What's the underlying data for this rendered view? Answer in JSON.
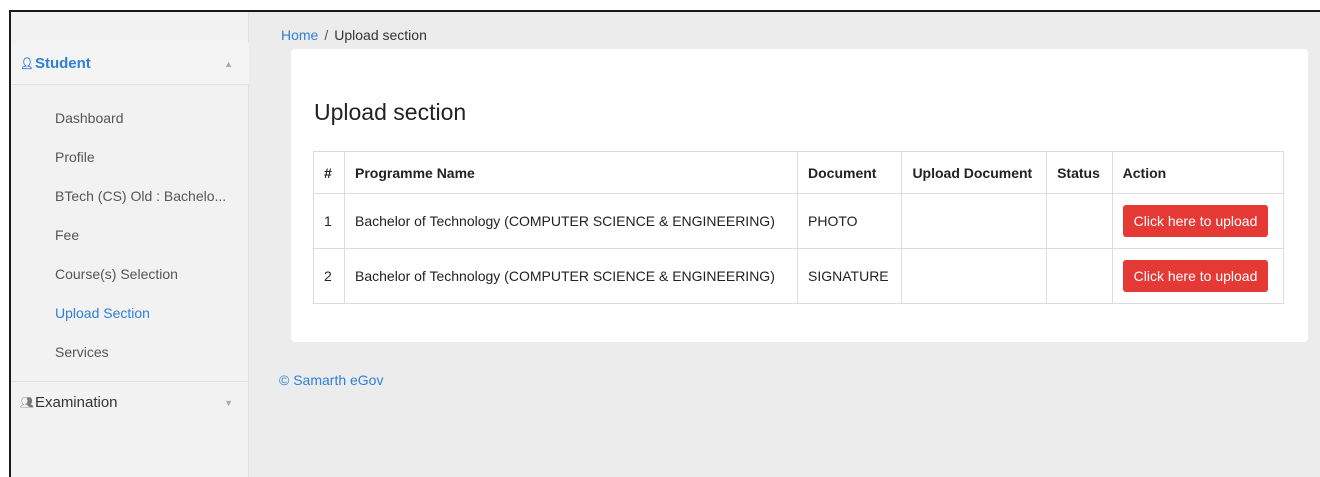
{
  "sidebar": {
    "student": {
      "icon": "person-icon",
      "label": "Student"
    },
    "items": [
      {
        "label": "Dashboard"
      },
      {
        "label": "Profile"
      },
      {
        "label": "BTech (CS) Old : Bachelo..."
      },
      {
        "label": "Fee"
      },
      {
        "label": "Course(s) Selection"
      },
      {
        "label": "Upload Section"
      },
      {
        "label": "Services"
      }
    ],
    "examination": {
      "icon": "people-icon",
      "label": "Examination"
    }
  },
  "breadcrumb": {
    "home": "Home",
    "separator": "/",
    "current": "Upload section"
  },
  "main": {
    "title": "Upload section",
    "table": {
      "headers": [
        "#",
        "Programme Name",
        "Document",
        "Upload Document",
        "Status",
        "Action"
      ],
      "rows": [
        {
          "num": "1",
          "programme": "Bachelor of Technology (COMPUTER SCIENCE & ENGINEERING)",
          "document": "PHOTO",
          "upload_document": "",
          "status": "",
          "action": "Click here to upload"
        },
        {
          "num": "2",
          "programme": "Bachelor of Technology (COMPUTER SCIENCE & ENGINEERING)",
          "document": "SIGNATURE",
          "upload_document": "",
          "status": "",
          "action": "Click here to upload"
        }
      ]
    }
  },
  "footer": {
    "text": "© Samarth eGov"
  },
  "colors": {
    "accent": "#2f7fd8",
    "danger": "#e53935",
    "background": "#ececec"
  }
}
